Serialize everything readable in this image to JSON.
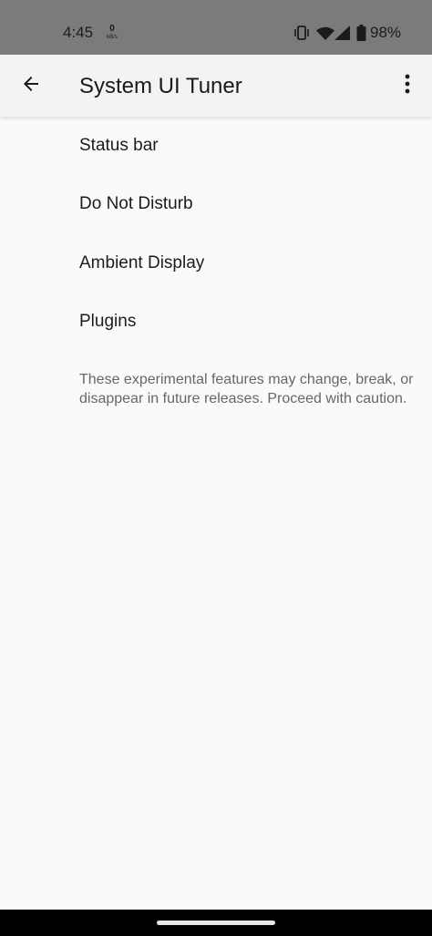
{
  "status_bar": {
    "time": "4:45",
    "net_speed_value": "0",
    "net_speed_unit": "kB/s",
    "battery_percent": "98%",
    "icons": [
      "vibrate-icon",
      "wifi-icon",
      "cellular-signal-icon",
      "battery-icon"
    ]
  },
  "app_bar": {
    "title": "System UI Tuner",
    "back_icon": "arrow-back-icon",
    "overflow_icon": "more-vert-icon"
  },
  "menu": {
    "items": [
      {
        "label": "Status bar"
      },
      {
        "label": "Do Not Disturb"
      },
      {
        "label": "Ambient Display"
      },
      {
        "label": "Plugins"
      }
    ]
  },
  "footer_note": "These experimental features may change, break, or disappear in future releases. Proceed with caution.",
  "colors": {
    "status_bar_bg": "#7b7b7b",
    "app_bar_bg": "#f3f3f3",
    "page_bg": "#fafafa",
    "primary_text": "#1c1c1c",
    "secondary_text": "#676767",
    "nav_bar_bg": "#000000"
  }
}
